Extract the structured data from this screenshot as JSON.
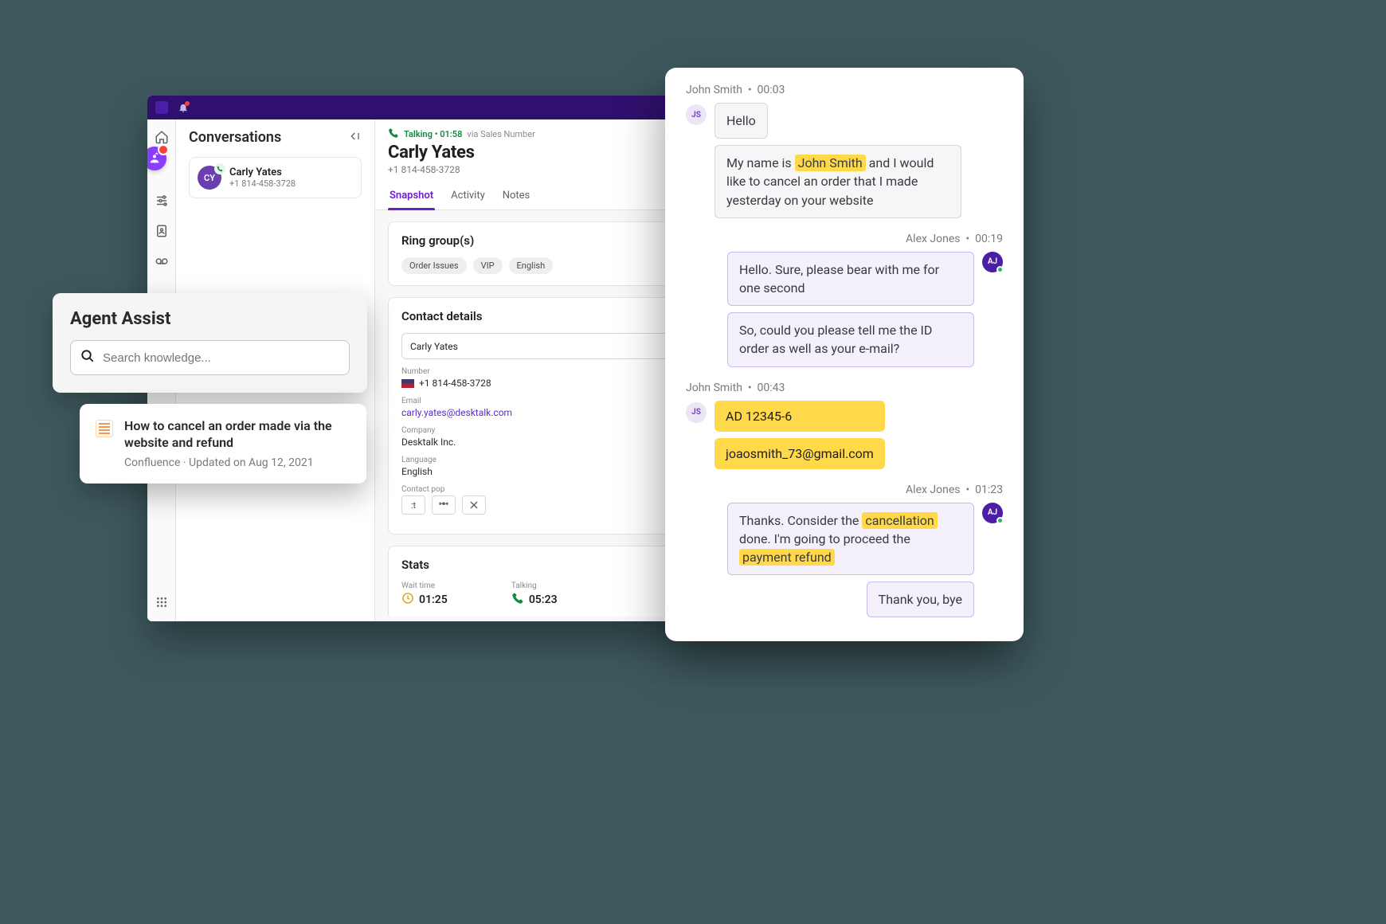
{
  "conversations": {
    "heading": "Conversations",
    "item": {
      "initials": "CY",
      "name": "Carly Yates",
      "phone": "+1 814-458-3728"
    }
  },
  "detail": {
    "status_label": "Talking",
    "status_time": "01:58",
    "via": "via Sales Number",
    "name": "Carly Yates",
    "phone": "+1 814-458-3728",
    "tabs": {
      "snapshot": "Snapshot",
      "activity": "Activity",
      "notes": "Notes"
    },
    "ring_groups": {
      "heading": "Ring group(s)",
      "chips": [
        "Order Issues",
        "VIP",
        "English"
      ]
    },
    "contact": {
      "heading": "Contact details",
      "select_value": "Carly Yates",
      "number_label": "Number",
      "number_value": "+1 814-458-3728",
      "email_label": "Email",
      "email_value": "carly.yates@desktalk.com",
      "company_label": "Company",
      "company_value": "Desktalk Inc.",
      "language_label": "Language",
      "language_value": "English",
      "contact_pop_label": "Contact pop"
    },
    "stats": {
      "heading": "Stats",
      "wait_label": "Wait time",
      "wait_value": "01:25",
      "talk_label": "Talking",
      "talk_value": "05:23"
    }
  },
  "assist": {
    "heading": "Agent Assist",
    "search_placeholder": "Search knowledge...",
    "card_title": "How to cancel an order made via the website and refund",
    "card_meta": "Confluence · Updated on Aug 12, 2021"
  },
  "chat": {
    "p1": {
      "name": "John Smith",
      "time": "00:03",
      "initials": "JS",
      "m1": "Hello",
      "m2_a": "My name is ",
      "m2_hl": "John Smith",
      "m2_b": " and I would like to cancel an order that I made yesterday on your website"
    },
    "p2": {
      "name": "Alex Jones",
      "time": "00:19",
      "initials": "AJ",
      "m1": "Hello. Sure, please bear with me for one second",
      "m2": "So, could you please tell me the ID order as well as your e-mail?"
    },
    "p3": {
      "name": "John Smith",
      "time": "00:43",
      "initials": "JS",
      "m1": "AD 12345-6",
      "m2": "joaosmith_73@gmail.com"
    },
    "p4": {
      "name": "Alex Jones",
      "time": "01:23",
      "initials": "AJ",
      "m1_a": "Thanks. Consider the ",
      "m1_hl1": "cancellation",
      "m1_b": " done. I'm going to proceed the ",
      "m1_hl2": "payment refund",
      "m2": "Thank you, bye"
    }
  }
}
